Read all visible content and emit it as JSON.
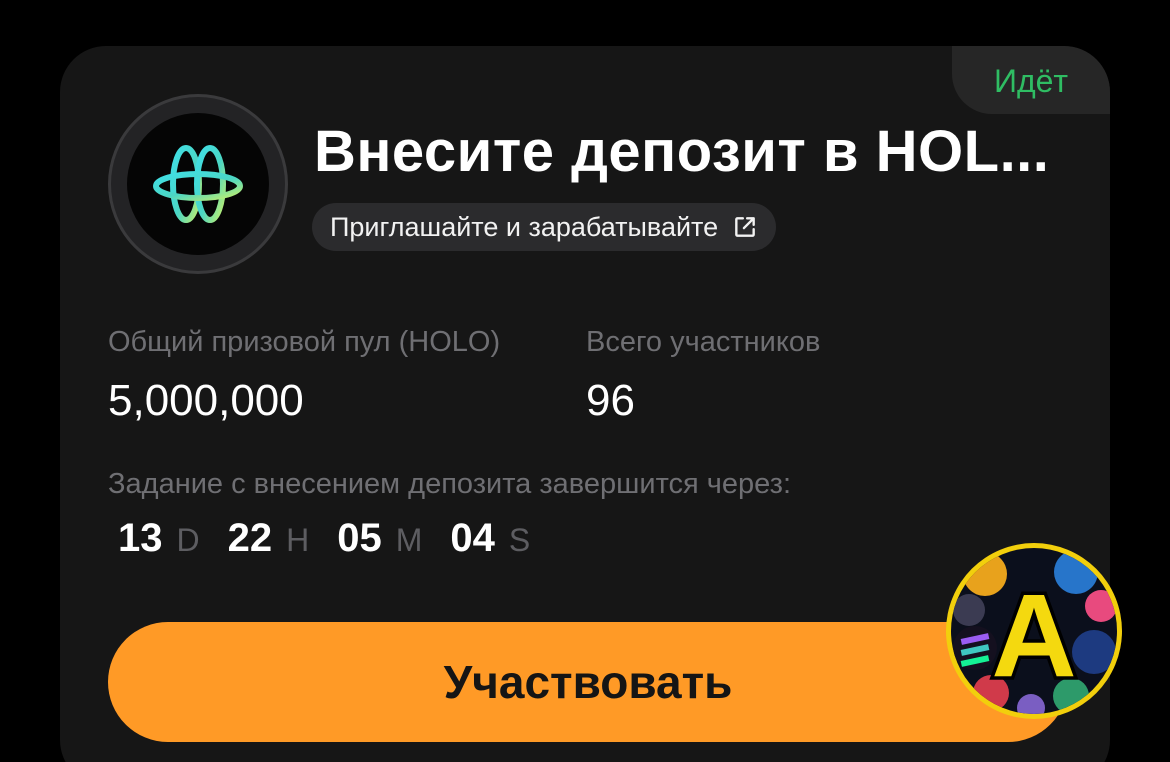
{
  "campaign": {
    "status": "Идёт",
    "title": "Внесите депозит в HOL...",
    "invite_label": "Приглашайте и зарабатывайте",
    "token_logo_icon": "holo-logo-icon"
  },
  "stats": {
    "prize_pool_label": "Общий призовой пул (HOLO)",
    "prize_pool_value": "5,000,000",
    "participants_label": "Всего участников",
    "participants_value": "96"
  },
  "countdown": {
    "label": "Задание с внесением депозита завершится через:",
    "days": "13",
    "days_unit": "D",
    "hours": "22",
    "hours_unit": "H",
    "minutes": "05",
    "minutes_unit": "M",
    "seconds": "04",
    "seconds_unit": "S"
  },
  "cta": {
    "label": "Участвовать"
  },
  "watermark": {
    "letter": "A"
  },
  "colors": {
    "background": "#000000",
    "card": "#161616",
    "accent_orange": "#ff9a26",
    "status_green": "#2fbd63",
    "muted_text": "#6f6f73",
    "badge_yellow": "#f2cf0c"
  }
}
